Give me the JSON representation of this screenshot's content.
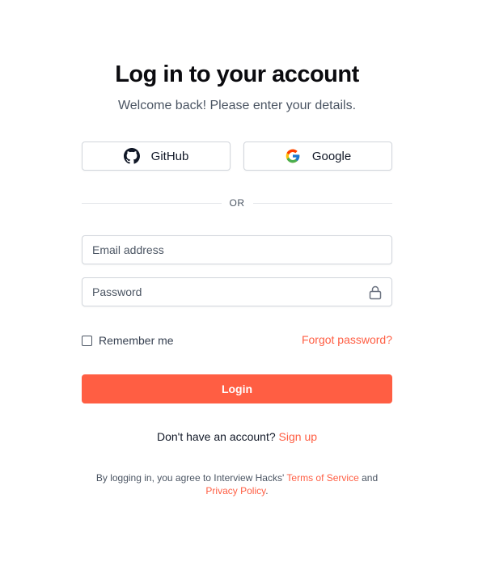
{
  "header": {
    "title": "Log in to your account",
    "subtitle": "Welcome back! Please enter your details."
  },
  "social": {
    "github_label": "GitHub",
    "github_icon": "github-icon",
    "google_label": "Google",
    "google_icon": "google-icon"
  },
  "divider": {
    "label": "OR"
  },
  "form": {
    "email": {
      "placeholder": "Email address",
      "value": ""
    },
    "password": {
      "placeholder": "Password",
      "value": "",
      "icon": "lock-icon"
    },
    "remember_label": "Remember me",
    "remember_checked": false,
    "forgot_label": "Forgot password?",
    "login_label": "Login"
  },
  "signup": {
    "prompt": "Don't have an account?",
    "link_label": "Sign up"
  },
  "legal": {
    "prefix": "By logging in, you agree to Interview Hacks'",
    "terms_label": "Terms of Service",
    "and": "and",
    "privacy_label": "Privacy Policy",
    "suffix": "."
  },
  "colors": {
    "accent": "#ff5e43",
    "title": "#0b0b0f",
    "muted": "#4b5563",
    "border": "#d1d5db"
  }
}
